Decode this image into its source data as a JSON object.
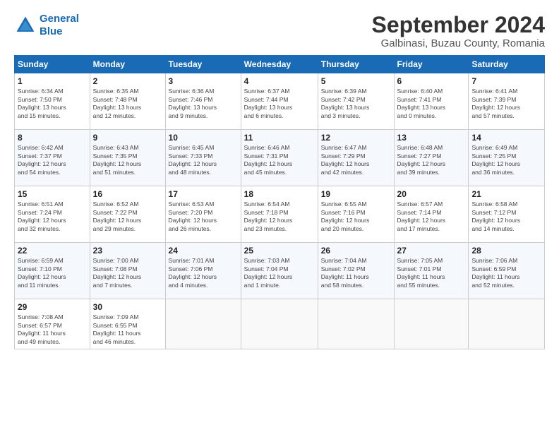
{
  "header": {
    "logo_line1": "General",
    "logo_line2": "Blue",
    "month_title": "September 2024",
    "subtitle": "Galbinasi, Buzau County, Romania"
  },
  "weekdays": [
    "Sunday",
    "Monday",
    "Tuesday",
    "Wednesday",
    "Thursday",
    "Friday",
    "Saturday"
  ],
  "weeks": [
    [
      {
        "day": "1",
        "detail": "Sunrise: 6:34 AM\nSunset: 7:50 PM\nDaylight: 13 hours\nand 15 minutes."
      },
      {
        "day": "2",
        "detail": "Sunrise: 6:35 AM\nSunset: 7:48 PM\nDaylight: 13 hours\nand 12 minutes."
      },
      {
        "day": "3",
        "detail": "Sunrise: 6:36 AM\nSunset: 7:46 PM\nDaylight: 13 hours\nand 9 minutes."
      },
      {
        "day": "4",
        "detail": "Sunrise: 6:37 AM\nSunset: 7:44 PM\nDaylight: 13 hours\nand 6 minutes."
      },
      {
        "day": "5",
        "detail": "Sunrise: 6:39 AM\nSunset: 7:42 PM\nDaylight: 13 hours\nand 3 minutes."
      },
      {
        "day": "6",
        "detail": "Sunrise: 6:40 AM\nSunset: 7:41 PM\nDaylight: 13 hours\nand 0 minutes."
      },
      {
        "day": "7",
        "detail": "Sunrise: 6:41 AM\nSunset: 7:39 PM\nDaylight: 12 hours\nand 57 minutes."
      }
    ],
    [
      {
        "day": "8",
        "detail": "Sunrise: 6:42 AM\nSunset: 7:37 PM\nDaylight: 12 hours\nand 54 minutes."
      },
      {
        "day": "9",
        "detail": "Sunrise: 6:43 AM\nSunset: 7:35 PM\nDaylight: 12 hours\nand 51 minutes."
      },
      {
        "day": "10",
        "detail": "Sunrise: 6:45 AM\nSunset: 7:33 PM\nDaylight: 12 hours\nand 48 minutes."
      },
      {
        "day": "11",
        "detail": "Sunrise: 6:46 AM\nSunset: 7:31 PM\nDaylight: 12 hours\nand 45 minutes."
      },
      {
        "day": "12",
        "detail": "Sunrise: 6:47 AM\nSunset: 7:29 PM\nDaylight: 12 hours\nand 42 minutes."
      },
      {
        "day": "13",
        "detail": "Sunrise: 6:48 AM\nSunset: 7:27 PM\nDaylight: 12 hours\nand 39 minutes."
      },
      {
        "day": "14",
        "detail": "Sunrise: 6:49 AM\nSunset: 7:25 PM\nDaylight: 12 hours\nand 36 minutes."
      }
    ],
    [
      {
        "day": "15",
        "detail": "Sunrise: 6:51 AM\nSunset: 7:24 PM\nDaylight: 12 hours\nand 32 minutes."
      },
      {
        "day": "16",
        "detail": "Sunrise: 6:52 AM\nSunset: 7:22 PM\nDaylight: 12 hours\nand 29 minutes."
      },
      {
        "day": "17",
        "detail": "Sunrise: 6:53 AM\nSunset: 7:20 PM\nDaylight: 12 hours\nand 26 minutes."
      },
      {
        "day": "18",
        "detail": "Sunrise: 6:54 AM\nSunset: 7:18 PM\nDaylight: 12 hours\nand 23 minutes."
      },
      {
        "day": "19",
        "detail": "Sunrise: 6:55 AM\nSunset: 7:16 PM\nDaylight: 12 hours\nand 20 minutes."
      },
      {
        "day": "20",
        "detail": "Sunrise: 6:57 AM\nSunset: 7:14 PM\nDaylight: 12 hours\nand 17 minutes."
      },
      {
        "day": "21",
        "detail": "Sunrise: 6:58 AM\nSunset: 7:12 PM\nDaylight: 12 hours\nand 14 minutes."
      }
    ],
    [
      {
        "day": "22",
        "detail": "Sunrise: 6:59 AM\nSunset: 7:10 PM\nDaylight: 12 hours\nand 11 minutes."
      },
      {
        "day": "23",
        "detail": "Sunrise: 7:00 AM\nSunset: 7:08 PM\nDaylight: 12 hours\nand 7 minutes."
      },
      {
        "day": "24",
        "detail": "Sunrise: 7:01 AM\nSunset: 7:06 PM\nDaylight: 12 hours\nand 4 minutes."
      },
      {
        "day": "25",
        "detail": "Sunrise: 7:03 AM\nSunset: 7:04 PM\nDaylight: 12 hours\nand 1 minute."
      },
      {
        "day": "26",
        "detail": "Sunrise: 7:04 AM\nSunset: 7:02 PM\nDaylight: 11 hours\nand 58 minutes."
      },
      {
        "day": "27",
        "detail": "Sunrise: 7:05 AM\nSunset: 7:01 PM\nDaylight: 11 hours\nand 55 minutes."
      },
      {
        "day": "28",
        "detail": "Sunrise: 7:06 AM\nSunset: 6:59 PM\nDaylight: 11 hours\nand 52 minutes."
      }
    ],
    [
      {
        "day": "29",
        "detail": "Sunrise: 7:08 AM\nSunset: 6:57 PM\nDaylight: 11 hours\nand 49 minutes."
      },
      {
        "day": "30",
        "detail": "Sunrise: 7:09 AM\nSunset: 6:55 PM\nDaylight: 11 hours\nand 46 minutes."
      },
      {
        "day": "",
        "detail": ""
      },
      {
        "day": "",
        "detail": ""
      },
      {
        "day": "",
        "detail": ""
      },
      {
        "day": "",
        "detail": ""
      },
      {
        "day": "",
        "detail": ""
      }
    ]
  ]
}
